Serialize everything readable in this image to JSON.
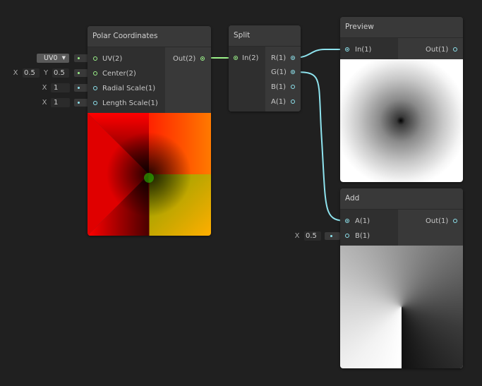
{
  "colors": {
    "background": "#202020",
    "node": "#393939",
    "vector2_port": "#9cf38a",
    "vector1_port": "#8ee3ee",
    "wire_vector2": "#9cf38a",
    "wire_vector1": "#8ee3ee"
  },
  "nodes": {
    "polar": {
      "title": "Polar Coordinates",
      "inputs": [
        {
          "label": "UV(2)"
        },
        {
          "label": "Center(2)"
        },
        {
          "label": "Radial Scale(1)"
        },
        {
          "label": "Length Scale(1)"
        }
      ],
      "outputs": [
        {
          "label": "Out(2)"
        }
      ],
      "controls": {
        "uv_dropdown": "UV0",
        "center_x_label": "X",
        "center_x": "0.5",
        "center_y_label": "Y",
        "center_y": "0.5",
        "radial_label": "X",
        "radial": "1",
        "length_label": "X",
        "length": "1"
      }
    },
    "split": {
      "title": "Split",
      "inputs": [
        {
          "label": "In(2)"
        }
      ],
      "outputs": [
        {
          "label": "R(1)"
        },
        {
          "label": "G(1)"
        },
        {
          "label": "B(1)"
        },
        {
          "label": "A(1)"
        }
      ]
    },
    "preview": {
      "title": "Preview",
      "inputs": [
        {
          "label": "In(1)"
        }
      ],
      "outputs": [
        {
          "label": "Out(1)"
        }
      ]
    },
    "add": {
      "title": "Add",
      "inputs": [
        {
          "label": "A(1)"
        },
        {
          "label": "B(1)"
        }
      ],
      "outputs": [
        {
          "label": "Out(1)"
        }
      ],
      "controls": {
        "b_label": "X",
        "b_value": "0.5"
      }
    }
  },
  "connections": [
    {
      "from": "polar.Out(2)",
      "to": "split.In(2)"
    },
    {
      "from": "split.R(1)",
      "to": "preview.In(1)"
    },
    {
      "from": "split.G(1)",
      "to": "add.A(1)"
    }
  ]
}
